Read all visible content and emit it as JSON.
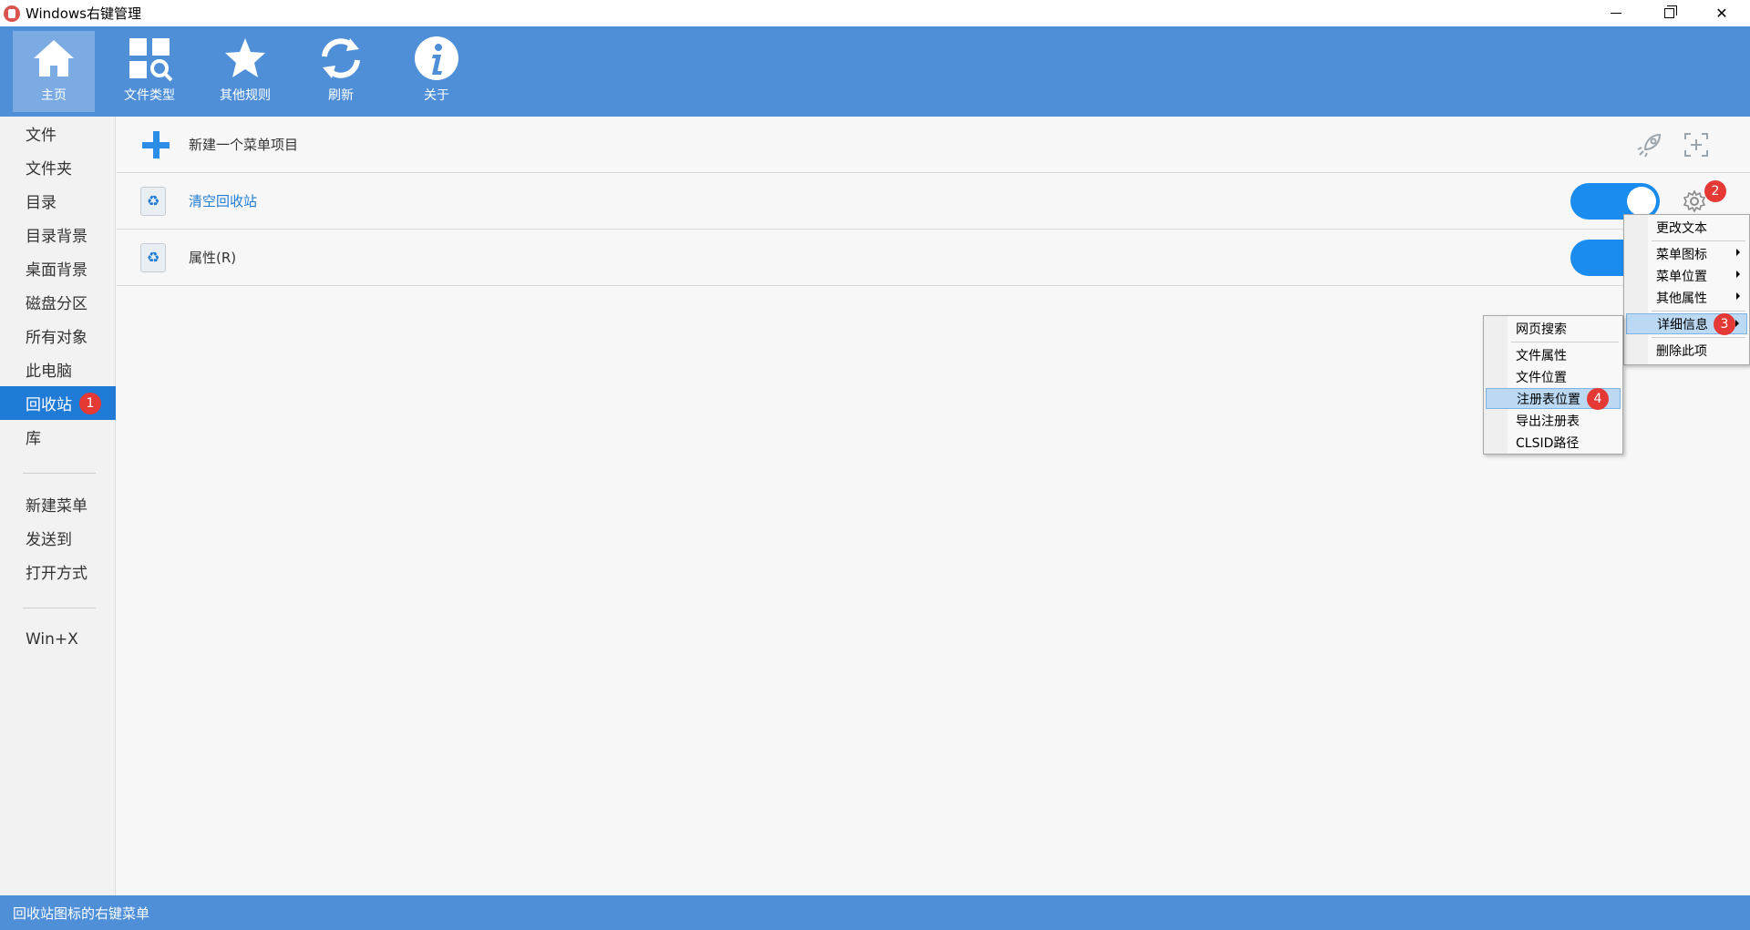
{
  "window": {
    "title": "Windows右键管理"
  },
  "toolbar": {
    "items": [
      {
        "label": "主页",
        "icon": "home-icon"
      },
      {
        "label": "文件类型",
        "icon": "file-types-icon"
      },
      {
        "label": "其他规则",
        "icon": "star-icon"
      },
      {
        "label": "刷新",
        "icon": "refresh-icon"
      },
      {
        "label": "关于",
        "icon": "info-icon"
      }
    ],
    "active": "主页"
  },
  "sidebar": {
    "items": [
      {
        "label": "文件"
      },
      {
        "label": "文件夹"
      },
      {
        "label": "目录"
      },
      {
        "label": "目录背景"
      },
      {
        "label": "桌面背景"
      },
      {
        "label": "磁盘分区"
      },
      {
        "label": "所有对象"
      },
      {
        "label": "此电脑"
      },
      {
        "label": "回收站",
        "badge": "1"
      },
      {
        "label": "库"
      },
      {
        "label": "新建菜单"
      },
      {
        "label": "发送到"
      },
      {
        "label": "打开方式"
      },
      {
        "label": "Win+X"
      }
    ],
    "selected": "回收站"
  },
  "main": {
    "new_item_label": "新建一个菜单项目",
    "rows": [
      {
        "label": "清空回收站",
        "enabled": true,
        "badge": "2"
      },
      {
        "label": "属性(R)",
        "enabled": true
      }
    ]
  },
  "context_menu": {
    "items": [
      {
        "label": "更改文本",
        "submenu": false
      },
      {
        "label": "菜单图标",
        "submenu": true
      },
      {
        "label": "菜单位置",
        "submenu": true
      },
      {
        "label": "其他属性",
        "submenu": true
      },
      {
        "label": "详细信息",
        "submenu": true,
        "badge": "3"
      },
      {
        "label": "删除此项",
        "submenu": false
      }
    ],
    "highlighted": "详细信息"
  },
  "sub_menu": {
    "items": [
      {
        "label": "网页搜索"
      },
      {
        "label": "文件属性"
      },
      {
        "label": "文件位置"
      },
      {
        "label": "注册表位置",
        "badge": "4"
      },
      {
        "label": "导出注册表"
      },
      {
        "label": "CLSID路径"
      }
    ],
    "highlighted": "注册表位置"
  },
  "status": {
    "text": "回收站图标的右键菜单"
  },
  "colors": {
    "accent": "#4f8fd8",
    "selected": "#1f7bd6",
    "toggle": "#1a8cef",
    "badge": "#e53935"
  }
}
